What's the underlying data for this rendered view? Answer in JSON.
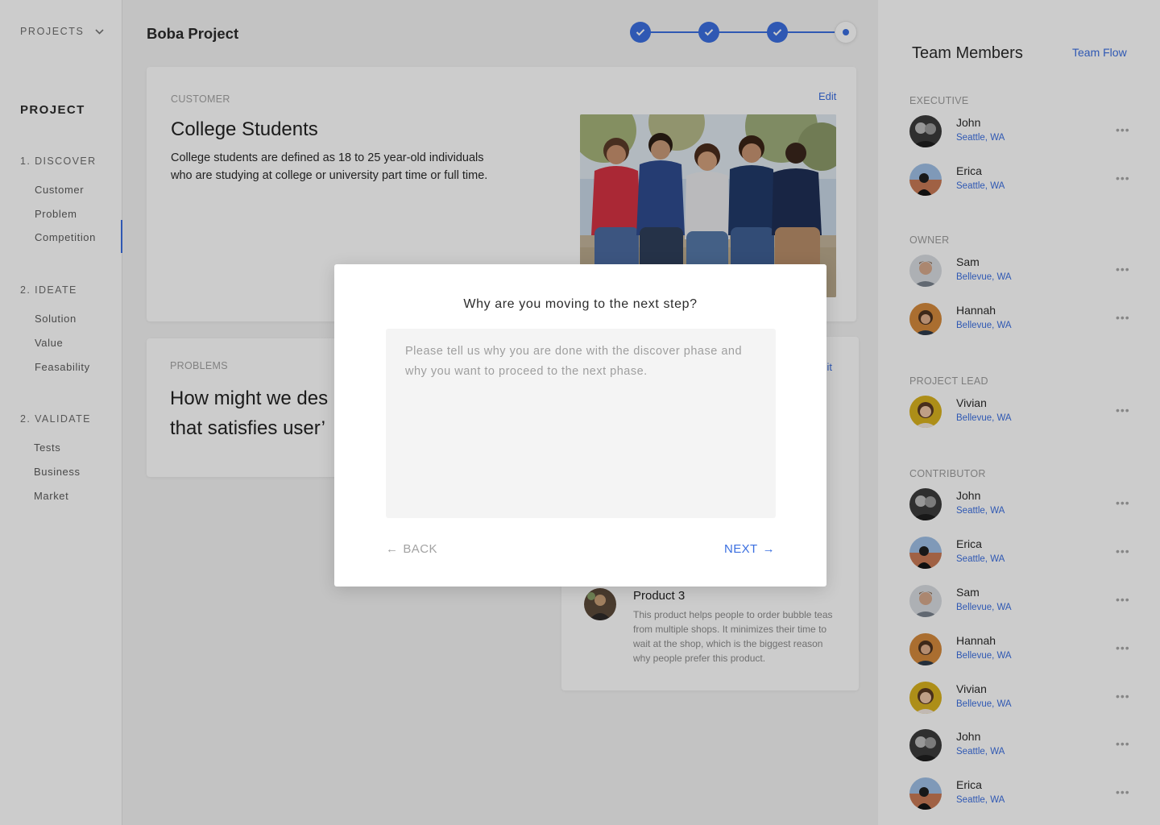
{
  "sidebar": {
    "projects_label": "PROJECTS",
    "project_heading": "PROJECT",
    "sections": [
      {
        "label": "1. DISCOVER",
        "items": [
          "Customer",
          "Problem",
          "Competition"
        ]
      },
      {
        "label": "2. IDEATE",
        "items": [
          "Solution",
          "Value",
          "Feasability"
        ]
      },
      {
        "label": "2. VALIDATE",
        "items": [
          "Tests",
          "Business",
          "Market"
        ]
      }
    ],
    "active_item": "Competition"
  },
  "main": {
    "title": "Boba Project",
    "stepper": {
      "total_steps": 4,
      "completed_steps": 3,
      "current_step": 4
    },
    "customer": {
      "label": "CUSTOMER",
      "edit_label": "Edit",
      "title": "College Students",
      "description_line1": "College students are defined as 18 to 25 year-old individuals",
      "description_line2": "who are studying at college or university part time or full time.",
      "photo_icon": "group-photo-icon"
    },
    "problems": {
      "label": "PROBLEMS",
      "line1": "How might we des",
      "line2": "that satisfies user’"
    },
    "products": {
      "edit_label": "Edit",
      "item": {
        "name": "Product 3",
        "description": "This product helps people to order bubble teas from multiple shops. It minimizes their time to wait at the shop, which is the biggest reason why people prefer this product."
      }
    }
  },
  "team": {
    "title": "Team Members",
    "link": "Team Flow",
    "groups": [
      {
        "label": "EXECUTIVE",
        "members": [
          {
            "name": "John",
            "location": "Seattle, WA"
          },
          {
            "name": "Erica",
            "location": "Seattle, WA"
          }
        ]
      },
      {
        "label": "OWNER",
        "members": [
          {
            "name": "Sam",
            "location": "Bellevue, WA"
          },
          {
            "name": "Hannah",
            "location": "Bellevue, WA"
          }
        ]
      },
      {
        "label": "PROJECT LEAD",
        "members": [
          {
            "name": "Vivian",
            "location": "Bellevue, WA"
          }
        ]
      },
      {
        "label": "CONTRIBUTOR",
        "members": [
          {
            "name": "John",
            "location": "Seattle, WA"
          },
          {
            "name": "Erica",
            "location": "Seattle, WA"
          },
          {
            "name": "Sam",
            "location": "Bellevue, WA"
          },
          {
            "name": "Hannah",
            "location": "Bellevue, WA"
          },
          {
            "name": "Vivian",
            "location": "Bellevue, WA"
          },
          {
            "name": "John",
            "location": "Seattle, WA"
          },
          {
            "name": "Erica",
            "location": "Seattle, WA"
          }
        ]
      }
    ],
    "more_glyph": "•••"
  },
  "modal": {
    "question": "Why are you moving to the next step?",
    "placeholder": "Please tell us why you are done with the discover phase and why you want to proceed to the next phase.",
    "value": "",
    "back_label": "BACK",
    "next_label": "NEXT",
    "back_arrow": "←",
    "next_arrow": "→"
  },
  "colors": {
    "accent": "#3b6fe0",
    "overlay": "rgba(0,0,0,0.2)",
    "muted_text": "#9e9e9e"
  }
}
